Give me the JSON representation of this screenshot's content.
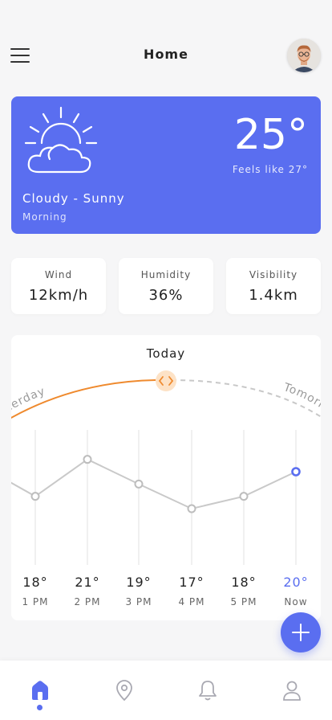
{
  "header": {
    "title": "Home",
    "menu_icon": "hamburger-menu-icon",
    "avatar": "user-avatar"
  },
  "weather": {
    "temperature": "25°",
    "feels_like": "Feels like 27°",
    "condition": "Cloudy - Sunny",
    "period": "Morning",
    "icon": "cloud-sun-icon",
    "card_color": "#5a6ef0"
  },
  "stats": [
    {
      "label": "Wind",
      "value": "12km/h"
    },
    {
      "label": "Humidity",
      "value": "36%"
    },
    {
      "label": "Visibility",
      "value": "1.4km"
    }
  ],
  "today": {
    "title": "Today",
    "prev_label": "Yesterday",
    "next_label": "Tomorrow",
    "arc_color": "#ef8a2e"
  },
  "chart_data": {
    "type": "line",
    "categories": [
      "1 PM",
      "2 PM",
      "3 PM",
      "4 PM",
      "5 PM",
      "Now"
    ],
    "values": [
      18,
      21,
      19,
      17,
      18,
      20
    ],
    "labels": [
      "18°",
      "21°",
      "19°",
      "17°",
      "18°",
      "20°"
    ],
    "highlight": "Now",
    "highlight_color": "#5a6ef0"
  },
  "fab": {
    "icon": "plus-icon"
  },
  "nav": {
    "items": [
      "home-icon",
      "location-pin-icon",
      "bell-icon",
      "profile-icon"
    ],
    "active": "home-icon"
  }
}
